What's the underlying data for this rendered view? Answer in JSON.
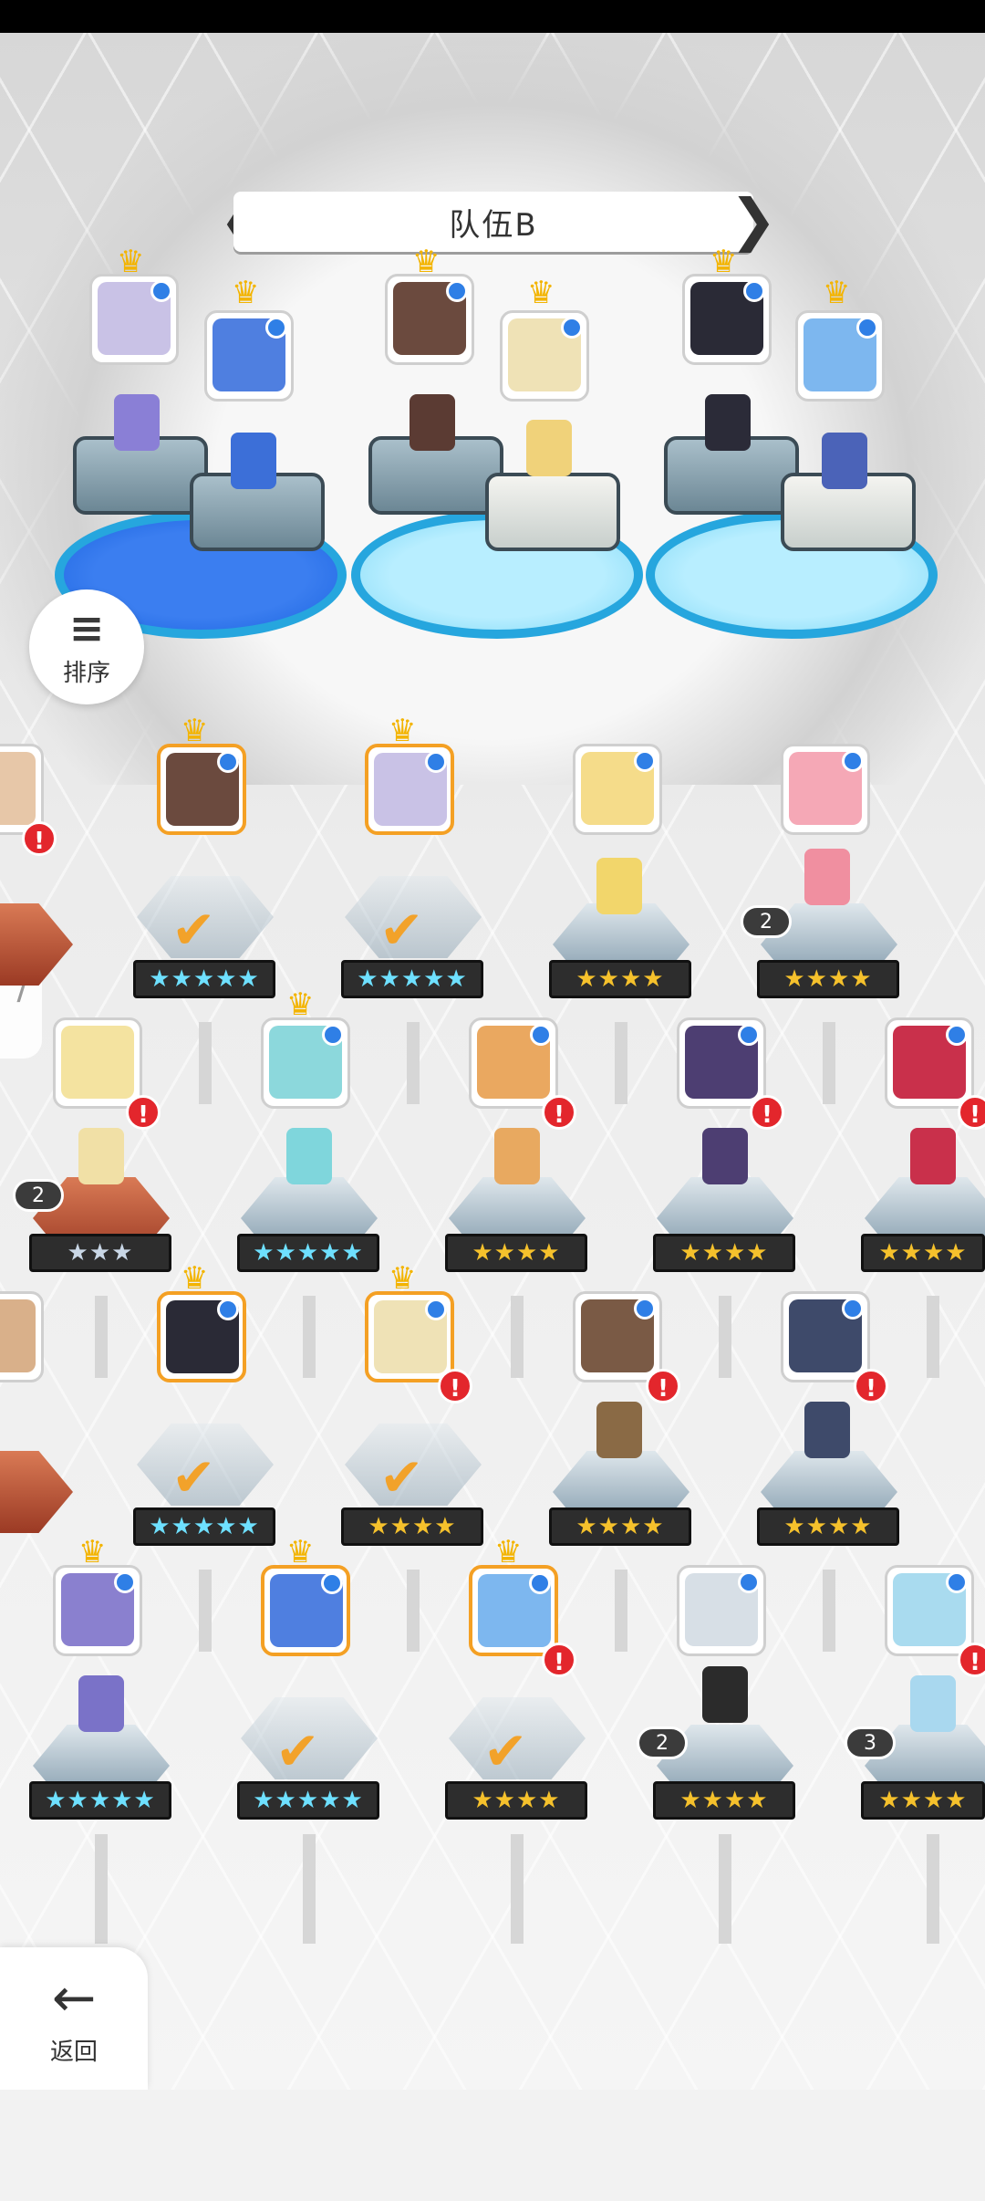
{
  "team": {
    "title": "队伍B",
    "prev_label": "❮",
    "next_label": "❯"
  },
  "sort_button": {
    "icon": "≡",
    "label": "排序"
  },
  "back_button": {
    "icon": "←",
    "label": "返回"
  },
  "side_tab": {
    "icon": "⟩"
  },
  "stars": {
    "five": "★★★★★",
    "four": "★★★★",
    "three": "★★★"
  },
  "checkmark": "✔",
  "alert_mark": "!",
  "crown": "♛",
  "counts": {
    "c1": "2",
    "c2": "2",
    "c3": "2",
    "c4": "3"
  },
  "colors": {
    "selected_border": "#f4a024",
    "alert": "#e3262c",
    "badge": "#2f7fe6",
    "gold_star": "#f5c12c"
  }
}
